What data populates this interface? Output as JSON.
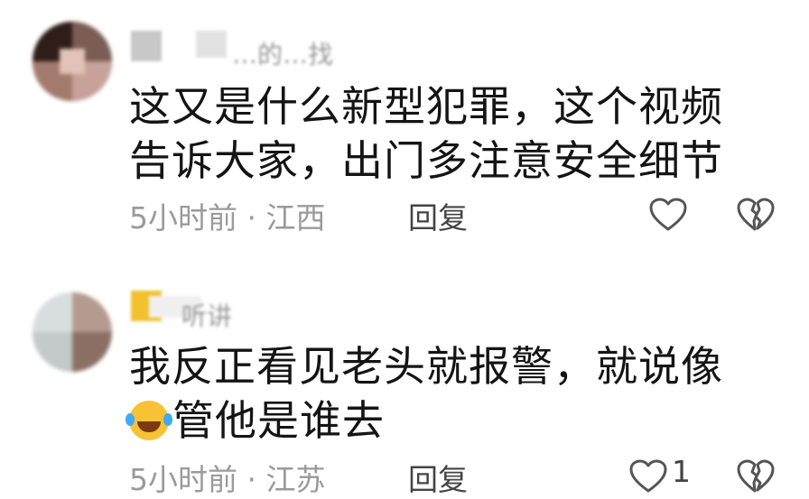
{
  "comments": [
    {
      "username": "…的…找",
      "text_lines": [
        "这又是什么新型犯罪，这个视频",
        "告诉大家，出门多注意安全细节"
      ],
      "time": "5小时前",
      "location": "江西",
      "reply_label": "回复"
    },
    {
      "username": "听讲",
      "text_lines": [
        "我反正看见老头就报警，就说像",
        "管他是谁去"
      ],
      "emoji": "rolling-on-floor-laughing-emoji",
      "time": "5小时前",
      "location": "江苏",
      "reply_label": "回复",
      "like_count": "1"
    }
  ],
  "separator": " · ",
  "colors": {
    "text": "#141414",
    "meta": "#9a9a9a",
    "icon": "#555555"
  }
}
